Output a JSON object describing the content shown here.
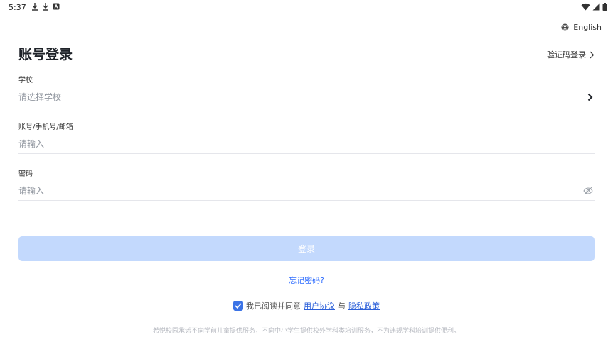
{
  "status_bar": {
    "time": "5:37"
  },
  "header": {
    "language_label": "English",
    "title": "账号登录",
    "code_login_label": "验证码登录"
  },
  "form": {
    "school": {
      "label": "学校",
      "placeholder": "请选择学校"
    },
    "account": {
      "label": "账号/手机号/邮箱",
      "placeholder": "请输入"
    },
    "password": {
      "label": "密码",
      "placeholder": "请输入"
    }
  },
  "login_button_label": "登录",
  "forgot_password_label": "忘记密码?",
  "agreement": {
    "checked": true,
    "prefix": "我已阅读并同意",
    "user_agreement": "用户协议",
    "conjunction": "与",
    "privacy_policy": "隐私政策"
  },
  "promise_text": "希悦校园承诺不向学前儿童提供服务，不向中小学生提供校外学科类培训服务，不为违规学科培训提供便利。",
  "colors": {
    "accent": "#3370ff",
    "button_disabled": "#c3d9fd",
    "checkbox": "#3b73e6"
  }
}
